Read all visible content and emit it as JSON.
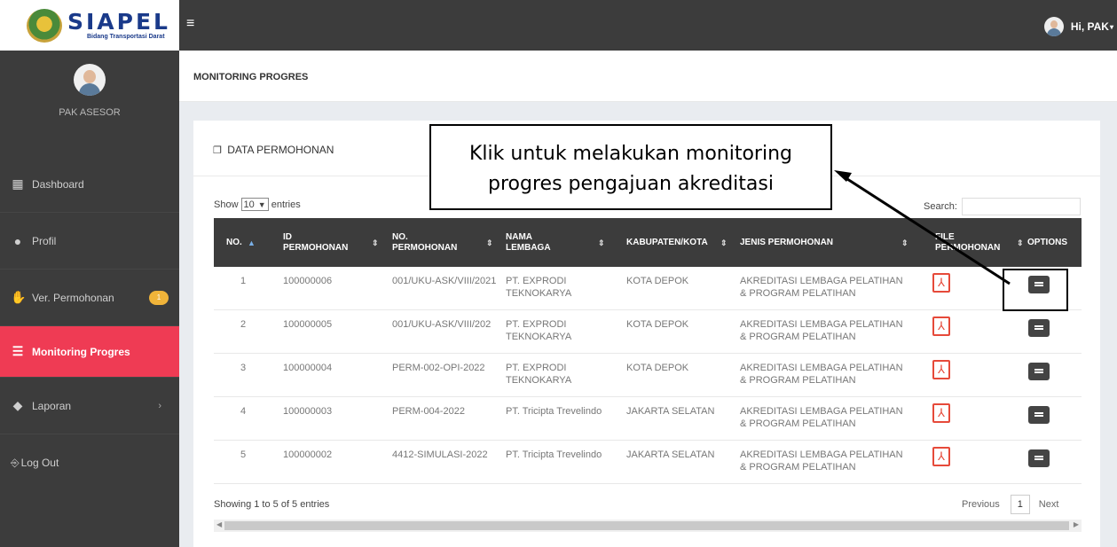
{
  "brand": {
    "title": "SIAPEL",
    "subtitle": "Bidang Transportasi Darat"
  },
  "user": {
    "name": "PAK ASESOR",
    "greeting": "Hi, PAK"
  },
  "sidebar": {
    "items": [
      {
        "label": "Dashboard",
        "icon": "dashboard-icon"
      },
      {
        "label": "Profil",
        "icon": "user-icon"
      },
      {
        "label": "Ver. Permohonan",
        "icon": "handshake-icon",
        "badge": "1"
      },
      {
        "label": "Monitoring Progres",
        "icon": "sliders-icon",
        "active": true
      },
      {
        "label": "Laporan",
        "icon": "layers-icon"
      }
    ],
    "logout": "Log Out"
  },
  "page": {
    "title": "MONITORING PROGRES"
  },
  "panel": {
    "title": "DATA PERMOHONAN",
    "show_label": "Show",
    "show_value": "10",
    "entries_label": "entries",
    "search_label": "Search:",
    "showing": "Showing 1 to 5 of 5 entries",
    "prev": "Previous",
    "page": "1",
    "next": "Next"
  },
  "table": {
    "headers": [
      "NO.",
      "ID PERMOHONAN",
      "NO. PERMOHONAN",
      "NAMA LEMBAGA",
      "KABUPATEN/KOTA",
      "JENIS PERMOHONAN",
      "FILE PERMOHONAN",
      "OPTIONS"
    ],
    "rows": [
      {
        "no": "1",
        "id": "100000006",
        "nomor": "001/UKU-ASK/VIII/2021",
        "lembaga": "PT. EXPRODI TEKNOKARYA",
        "kota": "KOTA DEPOK",
        "jenis": "AKREDITASI LEMBAGA PELATIHAN & PROGRAM PELATIHAN"
      },
      {
        "no": "2",
        "id": "100000005",
        "nomor": "001/UKU-ASK/VIII/202",
        "lembaga": "PT. EXPRODI TEKNOKARYA",
        "kota": "KOTA DEPOK",
        "jenis": "AKREDITASI LEMBAGA PELATIHAN & PROGRAM PELATIHAN"
      },
      {
        "no": "3",
        "id": "100000004",
        "nomor": "PERM-002-OPI-2022",
        "lembaga": "PT. EXPRODI TEKNOKARYA",
        "kota": "KOTA DEPOK",
        "jenis": "AKREDITASI LEMBAGA PELATIHAN & PROGRAM PELATIHAN"
      },
      {
        "no": "4",
        "id": "100000003",
        "nomor": "PERM-004-2022",
        "lembaga": "PT. Tricipta Trevelindo",
        "kota": "JAKARTA SELATAN",
        "jenis": "AKREDITASI LEMBAGA PELATIHAN & PROGRAM PELATIHAN"
      },
      {
        "no": "5",
        "id": "100000002",
        "nomor": "4412-SIMULASI-2022",
        "lembaga": "PT. Tricipta Trevelindo",
        "kota": "JAKARTA SELATAN",
        "jenis": "AKREDITASI LEMBAGA PELATIHAN & PROGRAM PELATIHAN"
      }
    ]
  },
  "callout": {
    "line1": "Klik untuk melakukan monitoring",
    "line2": "progres pengajuan akreditasi"
  },
  "colors": {
    "sidebar": "#3c3c3c",
    "active": "#ef3b54",
    "badge": "#f0b43a",
    "pdf": "#e64a3a"
  }
}
